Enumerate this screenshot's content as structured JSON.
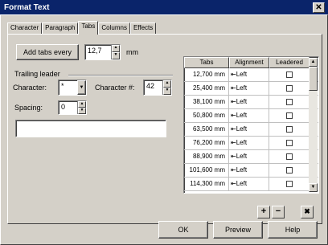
{
  "window": {
    "title": "Format Text",
    "close_glyph": "✕"
  },
  "tabs": [
    {
      "label": "Character"
    },
    {
      "label": "Paragraph"
    },
    {
      "label": "Tabs"
    },
    {
      "label": "Columns"
    },
    {
      "label": "Effects"
    }
  ],
  "add_tabs": {
    "button_label": "Add tabs every",
    "value": "12,7",
    "unit": "mm"
  },
  "trailing_leader": {
    "section_label": "Trailing leader",
    "character_label": "Character:",
    "character_value": "*",
    "character_num_label": "Character #:",
    "character_num_value": "42",
    "spacing_label": "Spacing:",
    "spacing_value": "0",
    "preview_text": ""
  },
  "table": {
    "headers": [
      "Tabs",
      "Alignment",
      "Leadered"
    ],
    "rows": [
      {
        "tab": "12,700 mm",
        "align": "Left"
      },
      {
        "tab": "25,400 mm",
        "align": "Left"
      },
      {
        "tab": "38,100 mm",
        "align": "Left"
      },
      {
        "tab": "50,800 mm",
        "align": "Left"
      },
      {
        "tab": "63,500 mm",
        "align": "Left"
      },
      {
        "tab": "76,200 mm",
        "align": "Left"
      },
      {
        "tab": "88,900 mm",
        "align": "Left"
      },
      {
        "tab": "101,600 mm",
        "align": "Left"
      },
      {
        "tab": "114,300 mm",
        "align": "Left"
      }
    ]
  },
  "table_actions": {
    "add_icon": "plus-icon",
    "remove_icon": "minus-icon",
    "clear_icon": "clear-all-icon"
  },
  "buttons": {
    "ok": "OK",
    "preview": "Preview",
    "help": "Help"
  }
}
